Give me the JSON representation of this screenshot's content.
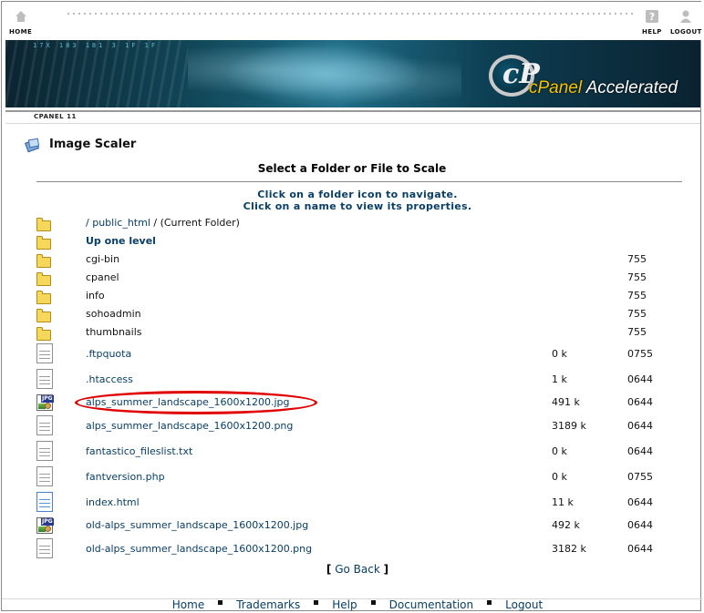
{
  "topnav": {
    "home_label": "HOME",
    "help_label": "HELP",
    "logout_label": "LOGOUT",
    "home_icon": "house-icon",
    "help_icon": "question-icon",
    "logout_icon": "person-icon"
  },
  "banner": {
    "logo_letter": "cP",
    "logo_brand": "cPanel",
    "logo_suffix": "Accelerated",
    "digits": "17X  183  181 3   1F   1F"
  },
  "version_label": "CPANEL 11",
  "page": {
    "title": "Image Scaler",
    "subheading": "Select a Folder or File to Scale",
    "instructions_line1": "Click on a folder icon to navigate.",
    "instructions_line2": "Click on a name to view its properties."
  },
  "current_folder": {
    "root_link": "/",
    "folder_link": "public_html",
    "suffix": "/ (Current Folder)"
  },
  "up_label": "Up one level",
  "folders": [
    {
      "name": "cgi-bin",
      "perm": "755"
    },
    {
      "name": "cpanel",
      "perm": "755"
    },
    {
      "name": "info",
      "perm": "755"
    },
    {
      "name": "sohoadmin",
      "perm": "755"
    },
    {
      "name": "thumbnails",
      "perm": "755"
    }
  ],
  "files": [
    {
      "name": ".ftpquota",
      "size": "0 k",
      "perm": "0755",
      "icon": "text-file-icon"
    },
    {
      "name": ".htaccess",
      "size": "1 k",
      "perm": "0644",
      "icon": "text-file-icon"
    },
    {
      "name": "alps_summer_landscape_1600x1200.jpg",
      "size": "491 k",
      "perm": "0644",
      "icon": "jpg-file-icon"
    },
    {
      "name": "alps_summer_landscape_1600x1200.png",
      "size": "3189 k",
      "perm": "0644",
      "icon": "text-file-icon"
    },
    {
      "name": "fantastico_fileslist.txt",
      "size": "0 k",
      "perm": "0644",
      "icon": "text-file-icon"
    },
    {
      "name": "fantversion.php",
      "size": "0 k",
      "perm": "0755",
      "icon": "text-file-icon"
    },
    {
      "name": "index.html",
      "size": "11 k",
      "perm": "0644",
      "icon": "html-file-icon"
    },
    {
      "name": "old-alps_summer_landscape_1600x1200.jpg",
      "size": "492 k",
      "perm": "0644",
      "icon": "jpg-file-icon"
    },
    {
      "name": "old-alps_summer_landscape_1600x1200.png",
      "size": "3182 k",
      "perm": "0644",
      "icon": "text-file-icon"
    }
  ],
  "go_back": "Go Back",
  "footer": [
    "Home",
    "Trademarks",
    "Help",
    "Documentation",
    "Logout"
  ],
  "colors": {
    "link": "#0a3e63",
    "highlight": "#e00000"
  }
}
